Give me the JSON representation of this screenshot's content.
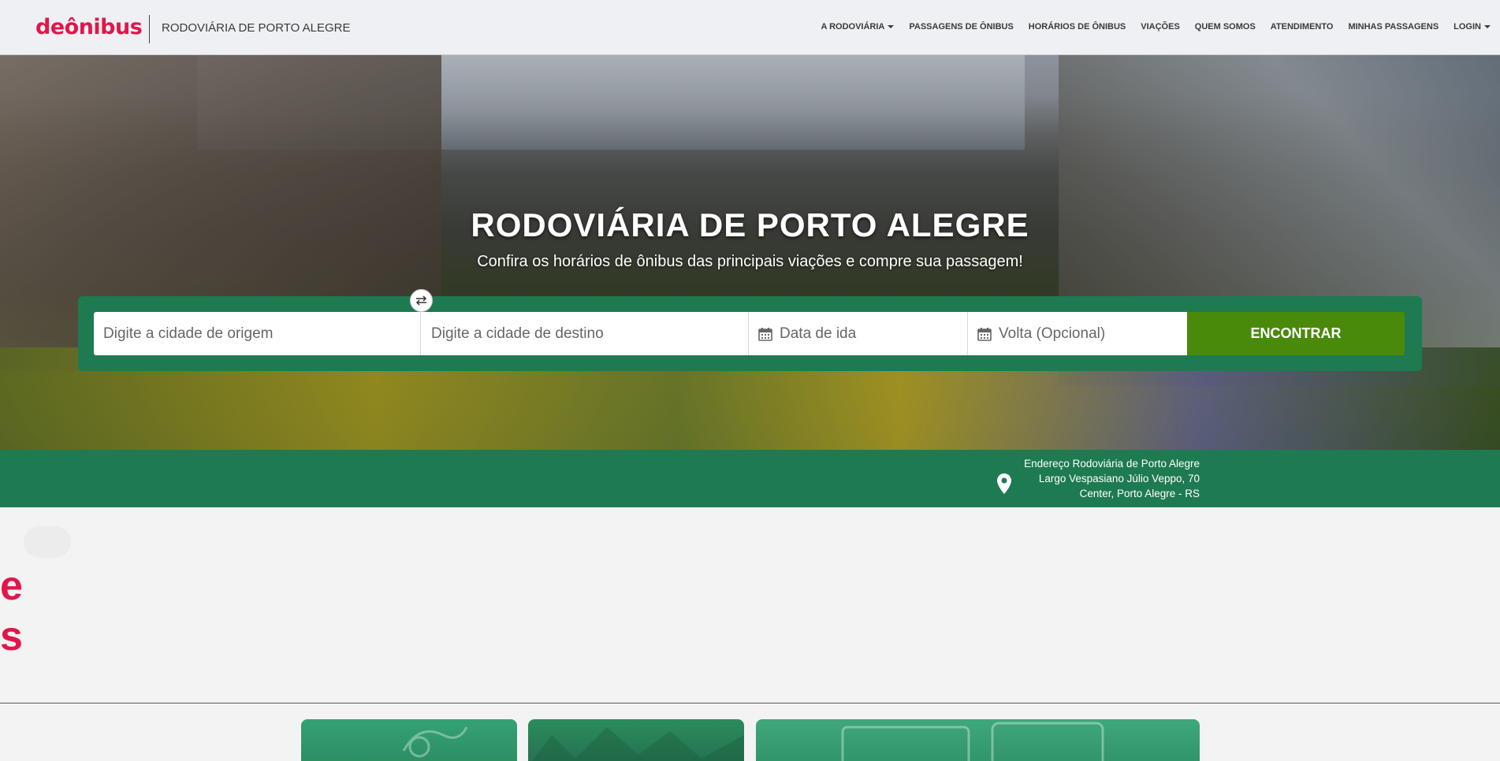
{
  "header": {
    "logo": "deônibus",
    "site_name": "RODOVIÁRIA DE PORTO ALEGRE",
    "nav": [
      {
        "label": "A RODOVIÁRIA",
        "dropdown": true
      },
      {
        "label": "PASSAGENS DE ÔNIBUS",
        "dropdown": false
      },
      {
        "label": "HORÁRIOS DE ÔNIBUS",
        "dropdown": false
      },
      {
        "label": "VIAÇÕES",
        "dropdown": false
      },
      {
        "label": "QUEM SOMOS",
        "dropdown": false
      },
      {
        "label": "ATENDIMENTO",
        "dropdown": false
      },
      {
        "label": "MINHAS PASSAGENS",
        "dropdown": false
      },
      {
        "label": "LOGIN",
        "dropdown": true
      }
    ]
  },
  "hero": {
    "title": "RODOVIÁRIA DE PORTO ALEGRE",
    "subtitle": "Confira os horários de ônibus das principais viações e compre sua passagem!"
  },
  "search": {
    "origin_placeholder": "Digite a cidade de origem",
    "destination_placeholder": "Digite a cidade de destino",
    "departure_placeholder": "Data de ida",
    "return_placeholder": "Volta (Opcional)",
    "submit_label": "ENCONTRAR"
  },
  "address": {
    "heading": "Endereço Rodoviária de Porto Alegre",
    "line1": "Largo Vespasiano Júlio Veppo, 70",
    "line2": "Center, Porto Alegre - RS"
  },
  "colors": {
    "brand": "#e0174a",
    "green": "#1e7a51",
    "button": "#4a8a0b"
  },
  "lower": {
    "partial_line1": "e",
    "partial_line2": "s"
  }
}
